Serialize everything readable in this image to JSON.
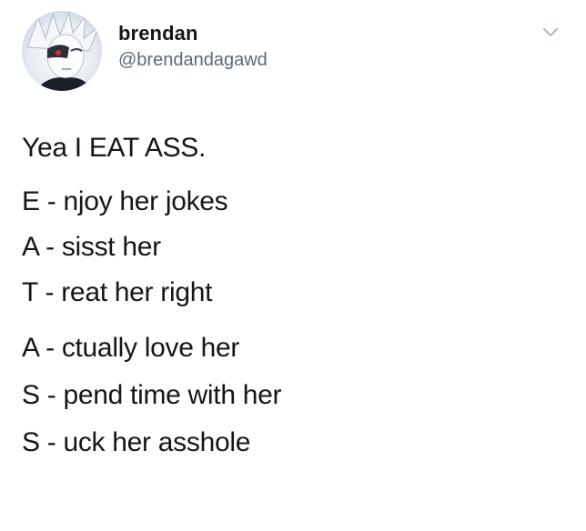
{
  "author": {
    "display_name": "brendan",
    "handle": "@brendandagawd",
    "avatar_icon": "anime-avatar-icon"
  },
  "menu": {
    "icon": "chevron-down-icon",
    "color": "#aab8c2"
  },
  "tweet": {
    "intro": "Yea I EAT ASS.",
    "group1": [
      "E - njoy her jokes",
      "A - sisst her",
      "T - reat her right"
    ],
    "group2": [
      "A - ctually love her",
      "S - pend time with her",
      "S - uck her asshole"
    ]
  },
  "colors": {
    "text": "#14171a",
    "secondary": "#5b6a78",
    "background": "#ffffff"
  }
}
